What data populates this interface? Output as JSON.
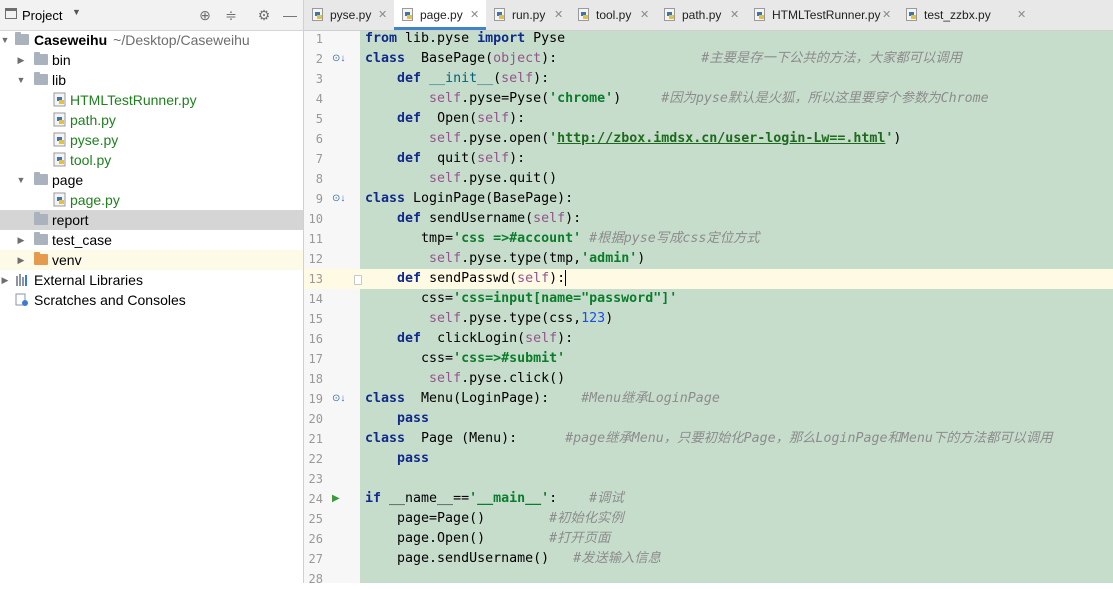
{
  "project_panel": {
    "title": "Project",
    "tree": [
      {
        "label": "Caseweihu",
        "path": "~/Desktop/Caseweihu"
      },
      {
        "label": "bin"
      },
      {
        "label": "lib"
      },
      {
        "label": "HTMLTestRunner.py"
      },
      {
        "label": "path.py"
      },
      {
        "label": "pyse.py"
      },
      {
        "label": "tool.py"
      },
      {
        "label": "page"
      },
      {
        "label": "page.py"
      },
      {
        "label": "report"
      },
      {
        "label": "test_case"
      },
      {
        "label": "venv"
      },
      {
        "label": "External Libraries"
      },
      {
        "label": "Scratches and Consoles"
      }
    ]
  },
  "tabs": [
    {
      "label": "pyse.py"
    },
    {
      "label": "page.py"
    },
    {
      "label": "run.py"
    },
    {
      "label": "tool.py"
    },
    {
      "label": "path.py"
    },
    {
      "label": "HTMLTestRunner.py"
    },
    {
      "label": "test_zzbx.py"
    }
  ],
  "active_tab": "page.py",
  "editor": {
    "current_line": 13,
    "lines": [
      {
        "n": "1",
        "code": "from lib.pyse import Pyse"
      },
      {
        "n": "2",
        "code": "class  BasePage(object):                  #主要是存一下公共的方法，大家都可以调用"
      },
      {
        "n": "3",
        "code": "    def __init__(self):"
      },
      {
        "n": "4",
        "code": "        self.pyse=Pyse('chrome')     #因为pyse默认是火狐，所以这里要穿个参数为Chrome"
      },
      {
        "n": "5",
        "code": "    def  Open(self):"
      },
      {
        "n": "6",
        "code": "        self.pyse.open('http://zbox.imdsx.cn/user-login-Lw==.html')"
      },
      {
        "n": "7",
        "code": "    def  quit(self):"
      },
      {
        "n": "8",
        "code": "        self.pyse.quit()"
      },
      {
        "n": "9",
        "code": "class LoginPage(BasePage):"
      },
      {
        "n": "10",
        "code": "    def sendUsername(self):"
      },
      {
        "n": "11",
        "code": "       tmp='css =>#account' #根据pyse写成css定位方式"
      },
      {
        "n": "12",
        "code": "        self.pyse.type(tmp,'admin')"
      },
      {
        "n": "13",
        "code": "    def sendPasswd(self):"
      },
      {
        "n": "14",
        "code": "       css='css=input[name=\"password\"]'"
      },
      {
        "n": "15",
        "code": "        self.pyse.type(css,123)"
      },
      {
        "n": "16",
        "code": "    def  clickLogin(self):"
      },
      {
        "n": "17",
        "code": "       css='css=>#submit'"
      },
      {
        "n": "18",
        "code": "        self.pyse.click()"
      },
      {
        "n": "19",
        "code": "class  Menu(LoginPage):    #Menu继承LoginPage"
      },
      {
        "n": "20",
        "code": "    pass"
      },
      {
        "n": "21",
        "code": "class  Page (Menu):      #page继承Menu，只要初始化Page，那么LoginPage和Menu下的方法都可以调用"
      },
      {
        "n": "22",
        "code": "    pass"
      },
      {
        "n": "23",
        "code": ""
      },
      {
        "n": "24",
        "code": "if __name__=='__main__':    #调试"
      },
      {
        "n": "25",
        "code": "    page=Page()        #初始化实例"
      },
      {
        "n": "26",
        "code": "    page.Open()        #打开页面"
      },
      {
        "n": "27",
        "code": "    page.sendUsername()   #发送输入信息"
      },
      {
        "n": "28",
        "code": ""
      }
    ]
  },
  "colors": {
    "code_highlight_bg": "#c7ddcc",
    "current_line_bg": "#fffae3",
    "py_file_label": "#208020",
    "active_tab_underline": "#4083c9"
  }
}
